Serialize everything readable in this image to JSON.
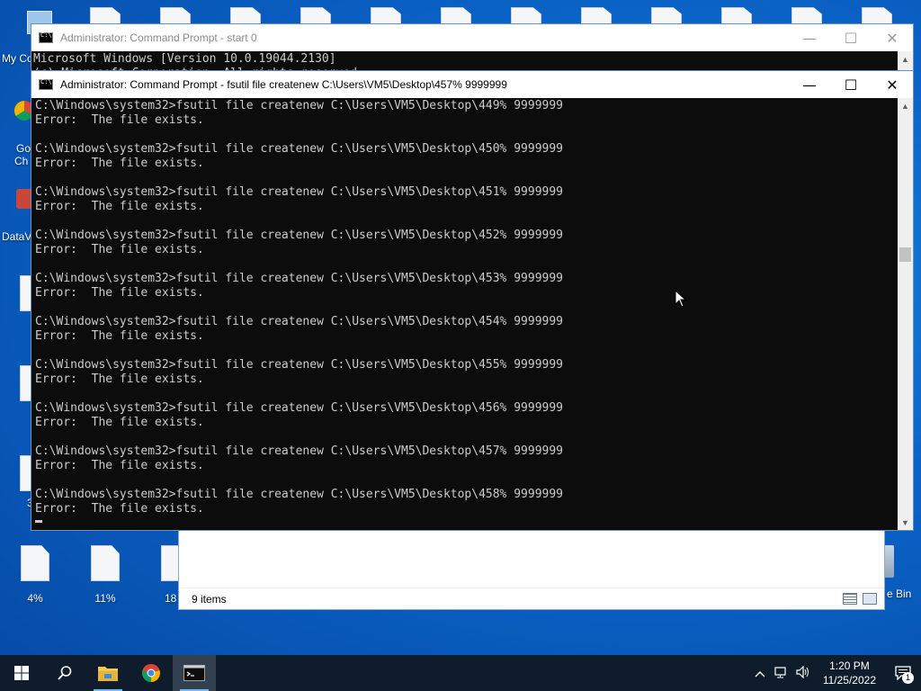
{
  "desktop": {
    "partial_labels": [
      "My Co",
      "Go",
      "Ch",
      "DataV",
      "3"
    ],
    "icons": [
      {
        "label": "4%"
      },
      {
        "label": "11%"
      },
      {
        "label": "18"
      }
    ],
    "recycle_label": "e Bin"
  },
  "explorer": {
    "status": "9 items"
  },
  "cmd_back": {
    "title": "Administrator: Command Prompt - start  0",
    "lines": [
      "Microsoft Windows [Version 10.0.19044.2130]",
      "(c) Microsoft Corporation. All rights reserved."
    ]
  },
  "cmd_front": {
    "title": "Administrator: Command Prompt - fsutil  file createnew C:\\Users\\VM5\\Desktop\\457% 9999999",
    "lines": [
      "C:\\Windows\\system32>fsutil file createnew C:\\Users\\VM5\\Desktop\\449% 9999999",
      "Error:  The file exists.",
      "",
      "C:\\Windows\\system32>fsutil file createnew C:\\Users\\VM5\\Desktop\\450% 9999999",
      "Error:  The file exists.",
      "",
      "C:\\Windows\\system32>fsutil file createnew C:\\Users\\VM5\\Desktop\\451% 9999999",
      "Error:  The file exists.",
      "",
      "C:\\Windows\\system32>fsutil file createnew C:\\Users\\VM5\\Desktop\\452% 9999999",
      "Error:  The file exists.",
      "",
      "C:\\Windows\\system32>fsutil file createnew C:\\Users\\VM5\\Desktop\\453% 9999999",
      "Error:  The file exists.",
      "",
      "C:\\Windows\\system32>fsutil file createnew C:\\Users\\VM5\\Desktop\\454% 9999999",
      "Error:  The file exists.",
      "",
      "C:\\Windows\\system32>fsutil file createnew C:\\Users\\VM5\\Desktop\\455% 9999999",
      "Error:  The file exists.",
      "",
      "C:\\Windows\\system32>fsutil file createnew C:\\Users\\VM5\\Desktop\\456% 9999999",
      "Error:  The file exists.",
      "",
      "C:\\Windows\\system32>fsutil file createnew C:\\Users\\VM5\\Desktop\\457% 9999999",
      "Error:  The file exists.",
      "",
      "C:\\Windows\\system32>fsutil file createnew C:\\Users\\VM5\\Desktop\\458% 9999999",
      "Error:  The file exists."
    ]
  },
  "window_controls": {
    "minimize": "—",
    "maximize": "☐",
    "close": "✕"
  },
  "taskbar": {
    "apps": [
      "start-icon",
      "search-icon",
      "file-explorer-icon",
      "chrome-icon",
      "command-prompt-icon"
    ],
    "time": "1:20 PM",
    "date": "11/25/2022",
    "notification_count": "1"
  }
}
